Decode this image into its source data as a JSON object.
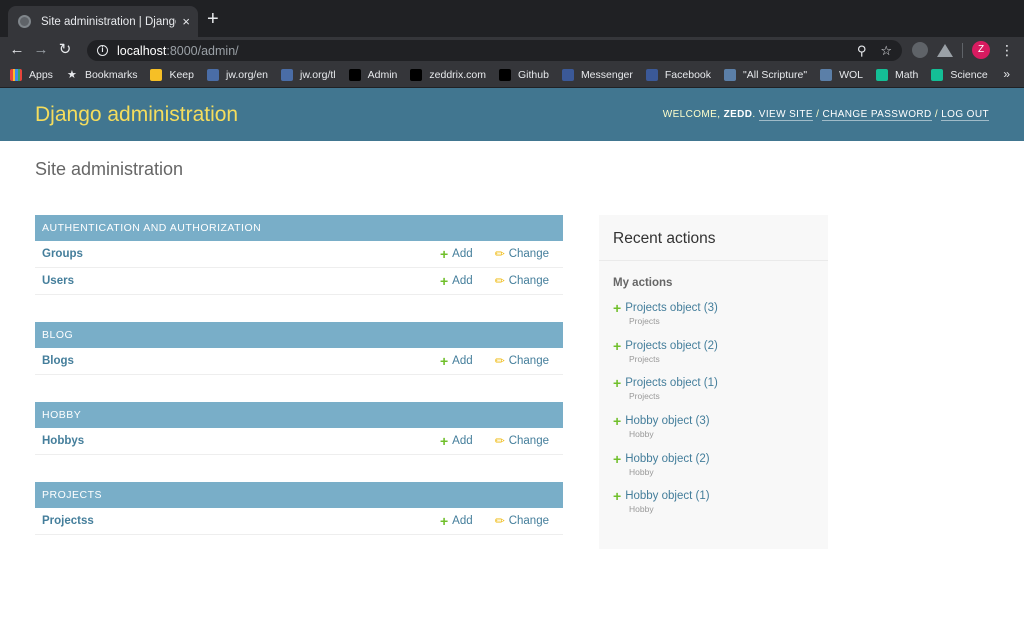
{
  "browser": {
    "tab_title": "Site administration | Django site",
    "tab_close": "×",
    "new_tab": "+",
    "url_host": "localhost",
    "url_rest": ":8000/admin/",
    "avatar_letter": "Z",
    "bookmarks": [
      {
        "label": "Apps",
        "icon": "apps-grid-icon",
        "color": "#e8453c"
      },
      {
        "label": "Bookmarks",
        "icon": "star-icon",
        "color": "#35363a"
      },
      {
        "label": "Keep",
        "icon": "keep-icon",
        "color": "#f6bf26"
      },
      {
        "label": "jw.org/en",
        "icon": "jw-icon",
        "color": "#4a6da7"
      },
      {
        "label": "jw.org/tl",
        "icon": "jw-icon",
        "color": "#4a6da7"
      },
      {
        "label": "Admin",
        "icon": "zeddrix-icon",
        "color": "#000000"
      },
      {
        "label": "zeddrix.com",
        "icon": "zeddrix-icon",
        "color": "#000000"
      },
      {
        "label": "Github",
        "icon": "github-icon",
        "color": "#000000"
      },
      {
        "label": "Messenger",
        "icon": "facebook-icon",
        "color": "#3b5998"
      },
      {
        "label": "Facebook",
        "icon": "facebook-icon",
        "color": "#3b5998"
      },
      {
        "label": "\"All Scripture\"",
        "icon": "book-icon",
        "color": "#5b7fa8"
      },
      {
        "label": "WOL",
        "icon": "book-icon",
        "color": "#5b7fa8"
      },
      {
        "label": "Math",
        "icon": "khan-icon",
        "color": "#14bf96"
      },
      {
        "label": "Science",
        "icon": "khan-icon",
        "color": "#14bf96"
      }
    ],
    "bookmarks_more": "»"
  },
  "header": {
    "branding": "Django administration",
    "welcome": "Welcome, ",
    "username": "Zedd",
    "view_site": "View site",
    "change_password": "Change password",
    "log_out": "Log out",
    "sep": " / "
  },
  "page": {
    "title": "Site administration"
  },
  "apps": [
    {
      "caption": "Authentication and Authorization",
      "models": [
        {
          "name": "Groups",
          "add": "Add",
          "change": "Change"
        },
        {
          "name": "Users",
          "add": "Add",
          "change": "Change"
        }
      ]
    },
    {
      "caption": "Blog",
      "models": [
        {
          "name": "Blogs",
          "add": "Add",
          "change": "Change"
        }
      ]
    },
    {
      "caption": "Hobby",
      "models": [
        {
          "name": "Hobbys",
          "add": "Add",
          "change": "Change"
        }
      ]
    },
    {
      "caption": "Projects",
      "models": [
        {
          "name": "Projectss",
          "add": "Add",
          "change": "Change"
        }
      ]
    }
  ],
  "recent_actions": {
    "title": "Recent actions",
    "subtitle": "My actions",
    "items": [
      {
        "label": "Projects object (3)",
        "type": "Projects"
      },
      {
        "label": "Projects object (2)",
        "type": "Projects"
      },
      {
        "label": "Projects object (1)",
        "type": "Projects"
      },
      {
        "label": "Hobby object (3)",
        "type": "Hobby"
      },
      {
        "label": "Hobby object (2)",
        "type": "Hobby"
      },
      {
        "label": "Hobby object (1)",
        "type": "Hobby"
      }
    ]
  },
  "colors": {
    "header_bg": "#417690",
    "branding": "#f5dd5d",
    "caption_bg": "#79aec8",
    "link": "#447e9b",
    "add_icon": "#70bf2b",
    "change_icon": "#efb80b"
  }
}
